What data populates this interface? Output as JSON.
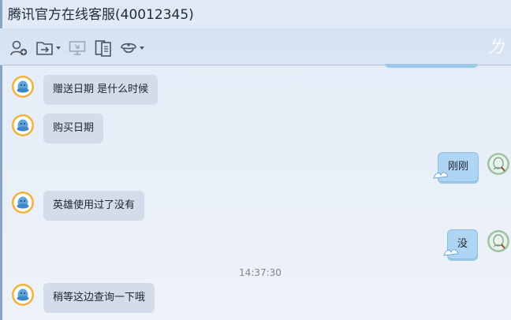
{
  "window": {
    "title": "腾讯官方在线客服(40012345)"
  },
  "toolbar": {
    "items": [
      {
        "icon": "add-contact-icon"
      },
      {
        "icon": "transfer-file-icon",
        "dropdown": true
      },
      {
        "icon": "remote-desktop-icon"
      },
      {
        "icon": "document-icon"
      },
      {
        "icon": "service-icon",
        "dropdown": true
      }
    ]
  },
  "chat": {
    "messages": [
      {
        "from": "agent",
        "text": "赠送日期 是什么时候"
      },
      {
        "from": "agent",
        "text": "购买日期"
      },
      {
        "from": "user",
        "text": "刚刚"
      },
      {
        "from": "agent",
        "text": "英雄使用过了没有"
      },
      {
        "from": "user",
        "text": "没"
      },
      {
        "timestamp": "14:37:30"
      },
      {
        "from": "agent",
        "text": "稍等这边查询一下哦"
      }
    ]
  },
  "colors": {
    "agent_bubble": "#d3dce8",
    "user_bubble": "#aed5f3",
    "background": "#e9eff8",
    "toolbar": "#d5e2f2"
  }
}
